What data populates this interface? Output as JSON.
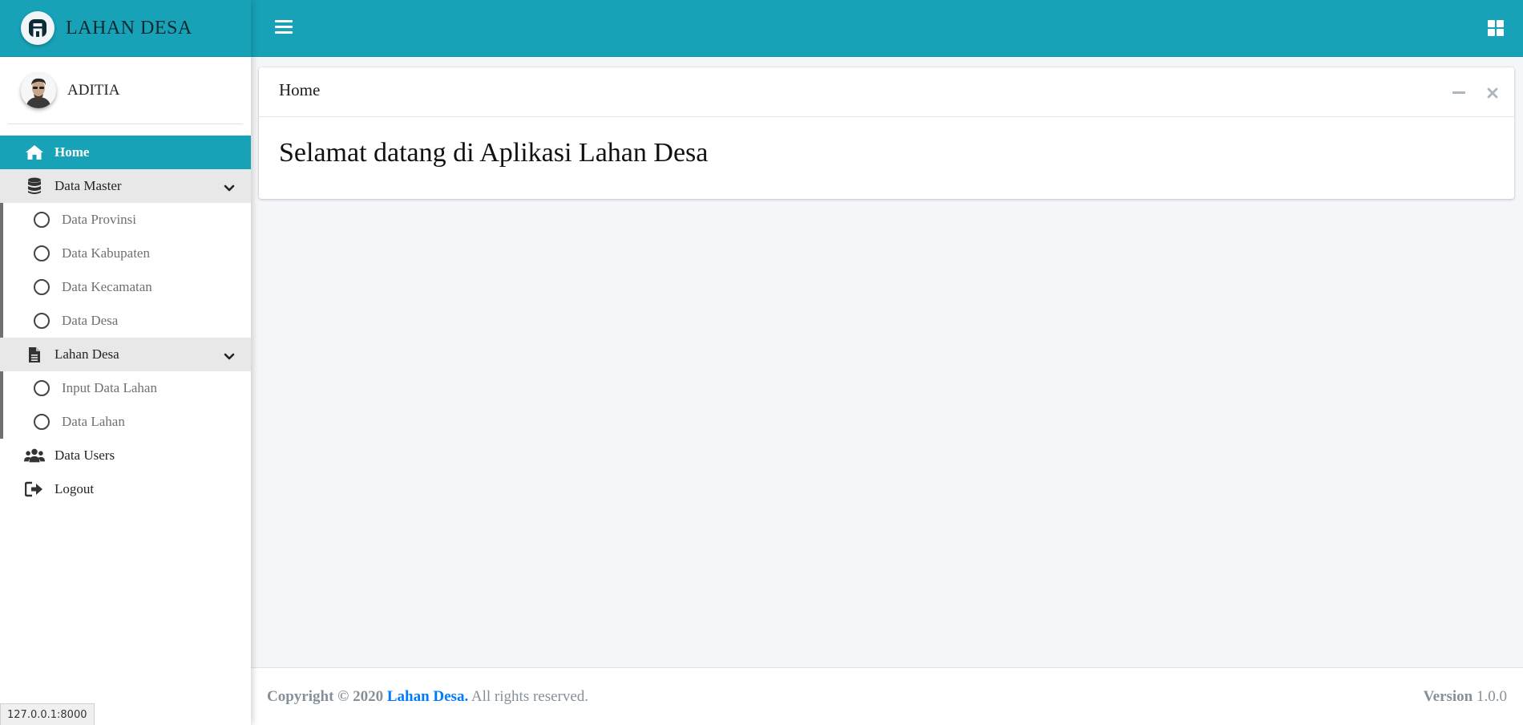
{
  "brand": {
    "logo_letter": "A",
    "name": "LAHAN DESA"
  },
  "user": {
    "name": "ADITIA"
  },
  "sidebar": {
    "home": {
      "label": "Home",
      "icon": "home-icon"
    },
    "data_master": {
      "label": "Data Master",
      "icon": "database-icon",
      "items": [
        {
          "label": "Data Provinsi"
        },
        {
          "label": "Data Kabupaten"
        },
        {
          "label": "Data Kecamatan"
        },
        {
          "label": "Data Desa"
        }
      ]
    },
    "lahan_desa": {
      "label": "Lahan Desa",
      "icon": "file-icon",
      "items": [
        {
          "label": "Input Data Lahan"
        },
        {
          "label": "Data Lahan"
        }
      ]
    },
    "data_users": {
      "label": "Data Users",
      "icon": "users-icon"
    },
    "logout": {
      "label": "Logout",
      "icon": "logout-icon"
    }
  },
  "card": {
    "title": "Home",
    "welcome": "Selamat datang di Aplikasi Lahan Desa"
  },
  "footer": {
    "copyright_prefix": "Copyright © 2020",
    "link_text": "Lahan Desa.",
    "suffix": "All rights reserved.",
    "version_label": "Version",
    "version_value": "1.0.0"
  },
  "status_bar": {
    "url": "127.0.0.1:8000"
  },
  "colors": {
    "accent": "#17a2b8",
    "link": "#007bff",
    "background": "#f4f6f9"
  }
}
